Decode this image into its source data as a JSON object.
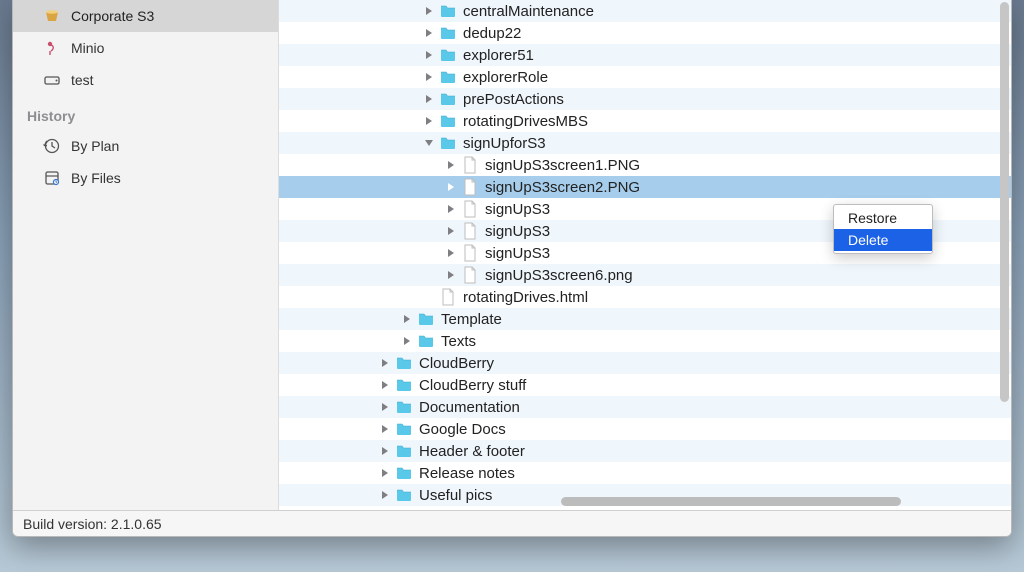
{
  "sidebar": {
    "accounts": [
      {
        "label": "Corporate S3",
        "icon": "bucket-icon",
        "selected": true
      },
      {
        "label": "Minio",
        "icon": "flamingo-icon",
        "selected": false
      },
      {
        "label": "test",
        "icon": "drive-icon",
        "selected": false
      }
    ],
    "history_header": "History",
    "history": [
      {
        "label": "By Plan",
        "icon": "history-plan-icon"
      },
      {
        "label": "By Files",
        "icon": "history-files-icon"
      }
    ]
  },
  "tree": [
    {
      "indent": 4,
      "name": "centralMaintenance",
      "type": "folder",
      "selected": false,
      "expanded": false
    },
    {
      "indent": 4,
      "name": "dedup22",
      "type": "folder",
      "selected": false,
      "expanded": false
    },
    {
      "indent": 4,
      "name": "explorer51",
      "type": "folder",
      "selected": false,
      "expanded": false
    },
    {
      "indent": 4,
      "name": "explorerRole",
      "type": "folder",
      "selected": false,
      "expanded": false
    },
    {
      "indent": 4,
      "name": "prePostActions",
      "type": "folder",
      "selected": false,
      "expanded": false
    },
    {
      "indent": 4,
      "name": "rotatingDrivesMBS",
      "type": "folder",
      "selected": false,
      "expanded": false
    },
    {
      "indent": 4,
      "name": "signUpforS3",
      "type": "folder",
      "selected": false,
      "expanded": true
    },
    {
      "indent": 5,
      "name": "signUpS3screen1.PNG",
      "type": "file",
      "selected": false,
      "expanded": false
    },
    {
      "indent": 5,
      "name": "signUpS3screen2.PNG",
      "type": "file",
      "selected": true,
      "expanded": false
    },
    {
      "indent": 5,
      "name": "signUpS3",
      "type": "file",
      "selected": false,
      "expanded": false
    },
    {
      "indent": 5,
      "name": "signUpS3",
      "type": "file",
      "selected": false,
      "expanded": false
    },
    {
      "indent": 5,
      "name": "signUpS3",
      "type": "file",
      "selected": false,
      "expanded": false
    },
    {
      "indent": 5,
      "name": "signUpS3screen6.png",
      "type": "file",
      "selected": false,
      "expanded": false
    },
    {
      "indent": 4,
      "name": "rotatingDrives.html",
      "type": "file-noarrow",
      "selected": false,
      "expanded": false
    },
    {
      "indent": 3,
      "name": "Template",
      "type": "folder",
      "selected": false,
      "expanded": false
    },
    {
      "indent": 3,
      "name": "Texts",
      "type": "folder",
      "selected": false,
      "expanded": false
    },
    {
      "indent": 2,
      "name": "CloudBerry",
      "type": "folder",
      "selected": false,
      "expanded": false
    },
    {
      "indent": 2,
      "name": "CloudBerry stuff",
      "type": "folder",
      "selected": false,
      "expanded": false
    },
    {
      "indent": 2,
      "name": "Documentation",
      "type": "folder",
      "selected": false,
      "expanded": false
    },
    {
      "indent": 2,
      "name": "Google Docs",
      "type": "folder",
      "selected": false,
      "expanded": false
    },
    {
      "indent": 2,
      "name": "Header & footer",
      "type": "folder",
      "selected": false,
      "expanded": false
    },
    {
      "indent": 2,
      "name": "Release notes",
      "type": "folder",
      "selected": false,
      "expanded": false
    },
    {
      "indent": 2,
      "name": "Useful pics",
      "type": "folder",
      "selected": false,
      "expanded": false
    }
  ],
  "context_menu": {
    "items": [
      {
        "label": "Restore",
        "hover": false
      },
      {
        "label": "Delete",
        "hover": true
      }
    ]
  },
  "statusbar": {
    "text": "Build version: 2.1.0.65"
  }
}
